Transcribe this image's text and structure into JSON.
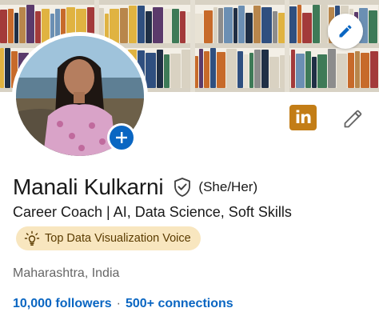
{
  "profile": {
    "name": "Manali Kulkarni",
    "pronouns": "(She/Her)",
    "headline": "Career Coach | AI, Data Science, Soft Skills",
    "voice_badge": "Top Data Visualization Voice",
    "location": "Maharashtra, India",
    "followers": "10,000 followers",
    "separator": "·",
    "connections": "500+ connections"
  },
  "brand": {
    "logo_text": "in",
    "accent_color": "#0a66c2",
    "badge_color": "#f8e6bf",
    "logo_color": "#c37d16"
  },
  "icons": {
    "banner_edit": "pencil-icon",
    "profile_edit": "pencil-icon",
    "add_photo": "plus-icon",
    "verified": "shield-check-icon",
    "voice": "lightbulb-icon"
  }
}
